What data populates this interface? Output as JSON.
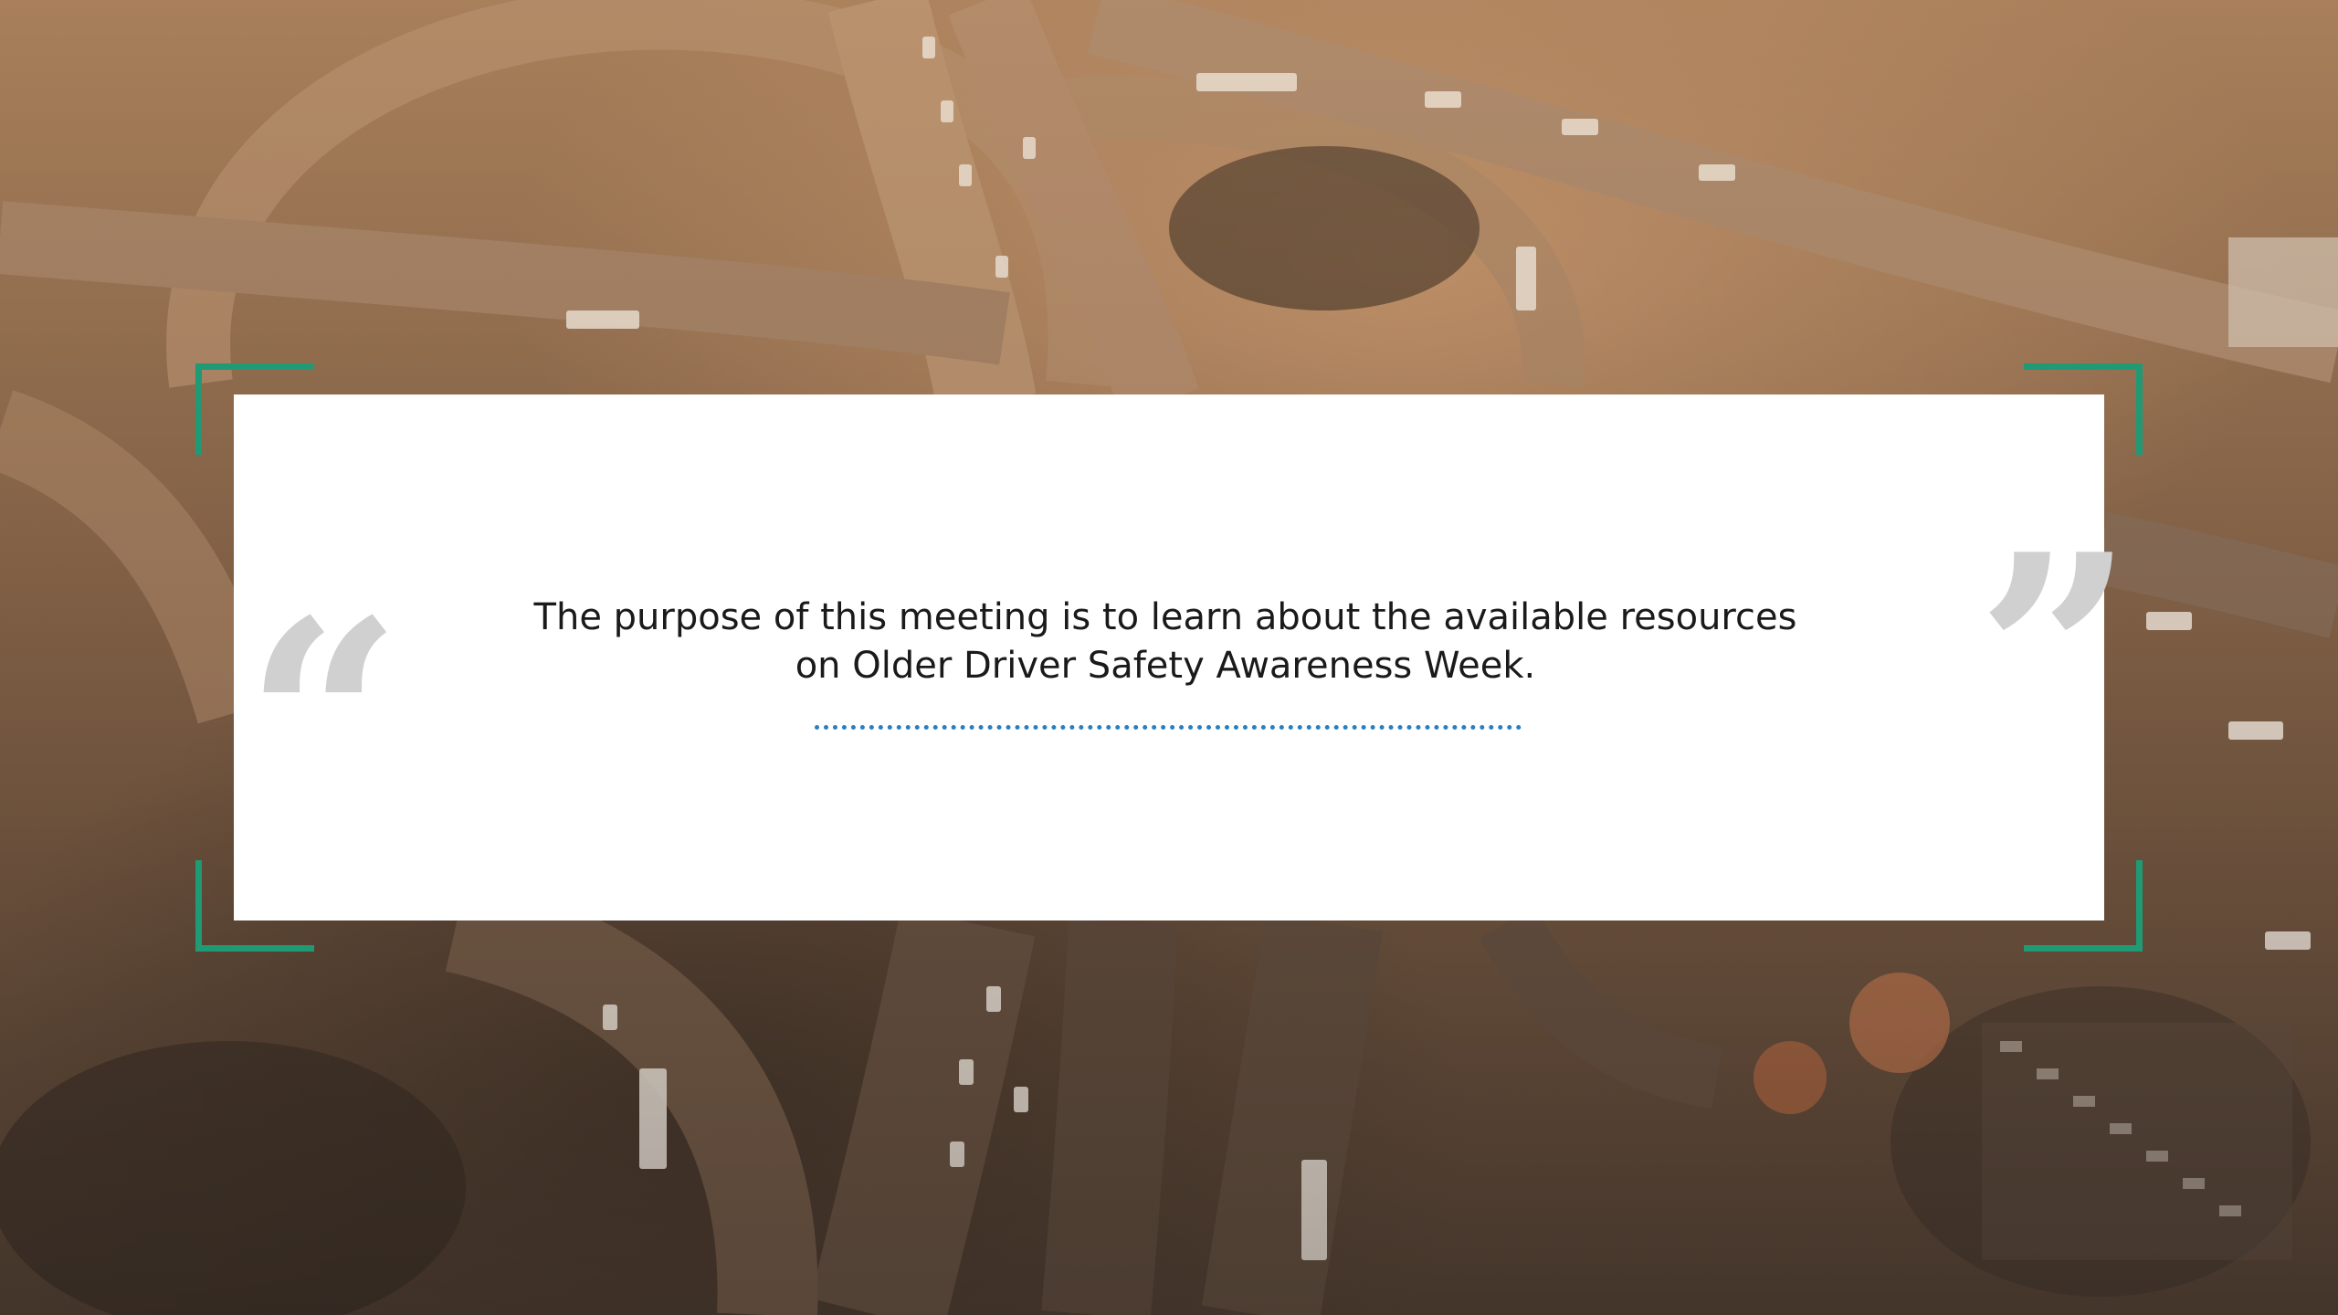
{
  "slide": {
    "quote": {
      "text": "The purpose of this meeting is to learn about the available resources on Older Driver Safety Awareness Week.",
      "open_mark": "“",
      "close_mark": "”"
    },
    "colors": {
      "accent_frame": "#1f9a75",
      "divider": "#2a7fc0",
      "quote_mark": "#d0d0d0",
      "card_background": "#ffffff",
      "text": "#1a1a1a"
    },
    "background": {
      "description_icon": "aerial-highway-image"
    }
  }
}
